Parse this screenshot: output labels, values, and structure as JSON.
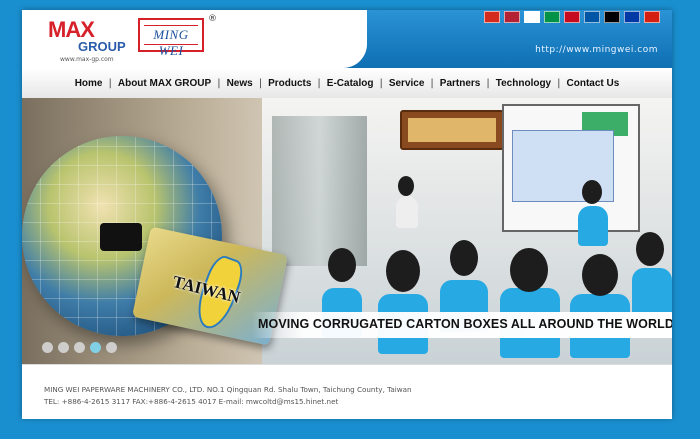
{
  "header": {
    "max_logo_text": "MAX",
    "group_logo_text": "GROUP",
    "max_url": "www.max-gp.com",
    "ming_wei_logo": "MING WEI",
    "registered_mark": "®",
    "site_url": "http://www.mingwei.com",
    "language_flags": [
      {
        "name": "taiwan-flag-icon",
        "color": "#d52b1e"
      },
      {
        "name": "usa-flag-icon",
        "color": "#b22234"
      },
      {
        "name": "japan-flag-icon",
        "color": "#ffffff"
      },
      {
        "name": "italy-flag-icon",
        "color": "#009246"
      },
      {
        "name": "spain-flag-icon",
        "color": "#c60b1e"
      },
      {
        "name": "france-flag-icon",
        "color": "#0055a4"
      },
      {
        "name": "germany-flag-icon",
        "color": "#000000"
      },
      {
        "name": "russia-flag-icon",
        "color": "#0039a6"
      },
      {
        "name": "afghanistan-flag-icon",
        "color": "#d32011"
      }
    ]
  },
  "nav": {
    "items": [
      "Home",
      "About MAX GROUP",
      "News",
      "Products",
      "E-Catalog",
      "Service",
      "Partners",
      "Technology",
      "Contact Us"
    ],
    "separator": "|"
  },
  "hero": {
    "taiwan_label": "TAIWAN",
    "banner_text": "MOVING CORRUGATED CARTON BOXES ALL AROUND THE WORLD",
    "slide_count": 5,
    "active_slide": 4
  },
  "footer": {
    "line1": "MING WEI PAPERWARE MACHINERY CO., LTD. NO.1 Qingquan Rd. Shalu Town, Taichung County, Taiwan",
    "line2": "TEL: +886-4-2615 3117 FAX:+886-4-2615 4017   E-mail: mwcoltd@ms15.hinet.net"
  },
  "colors": {
    "page_bg": "#1a8fd0",
    "header_blue": "#0f6fb3",
    "brand_red": "#d6202a",
    "brand_blue": "#1d4f9c",
    "active_dot": "#7fd8f3"
  }
}
